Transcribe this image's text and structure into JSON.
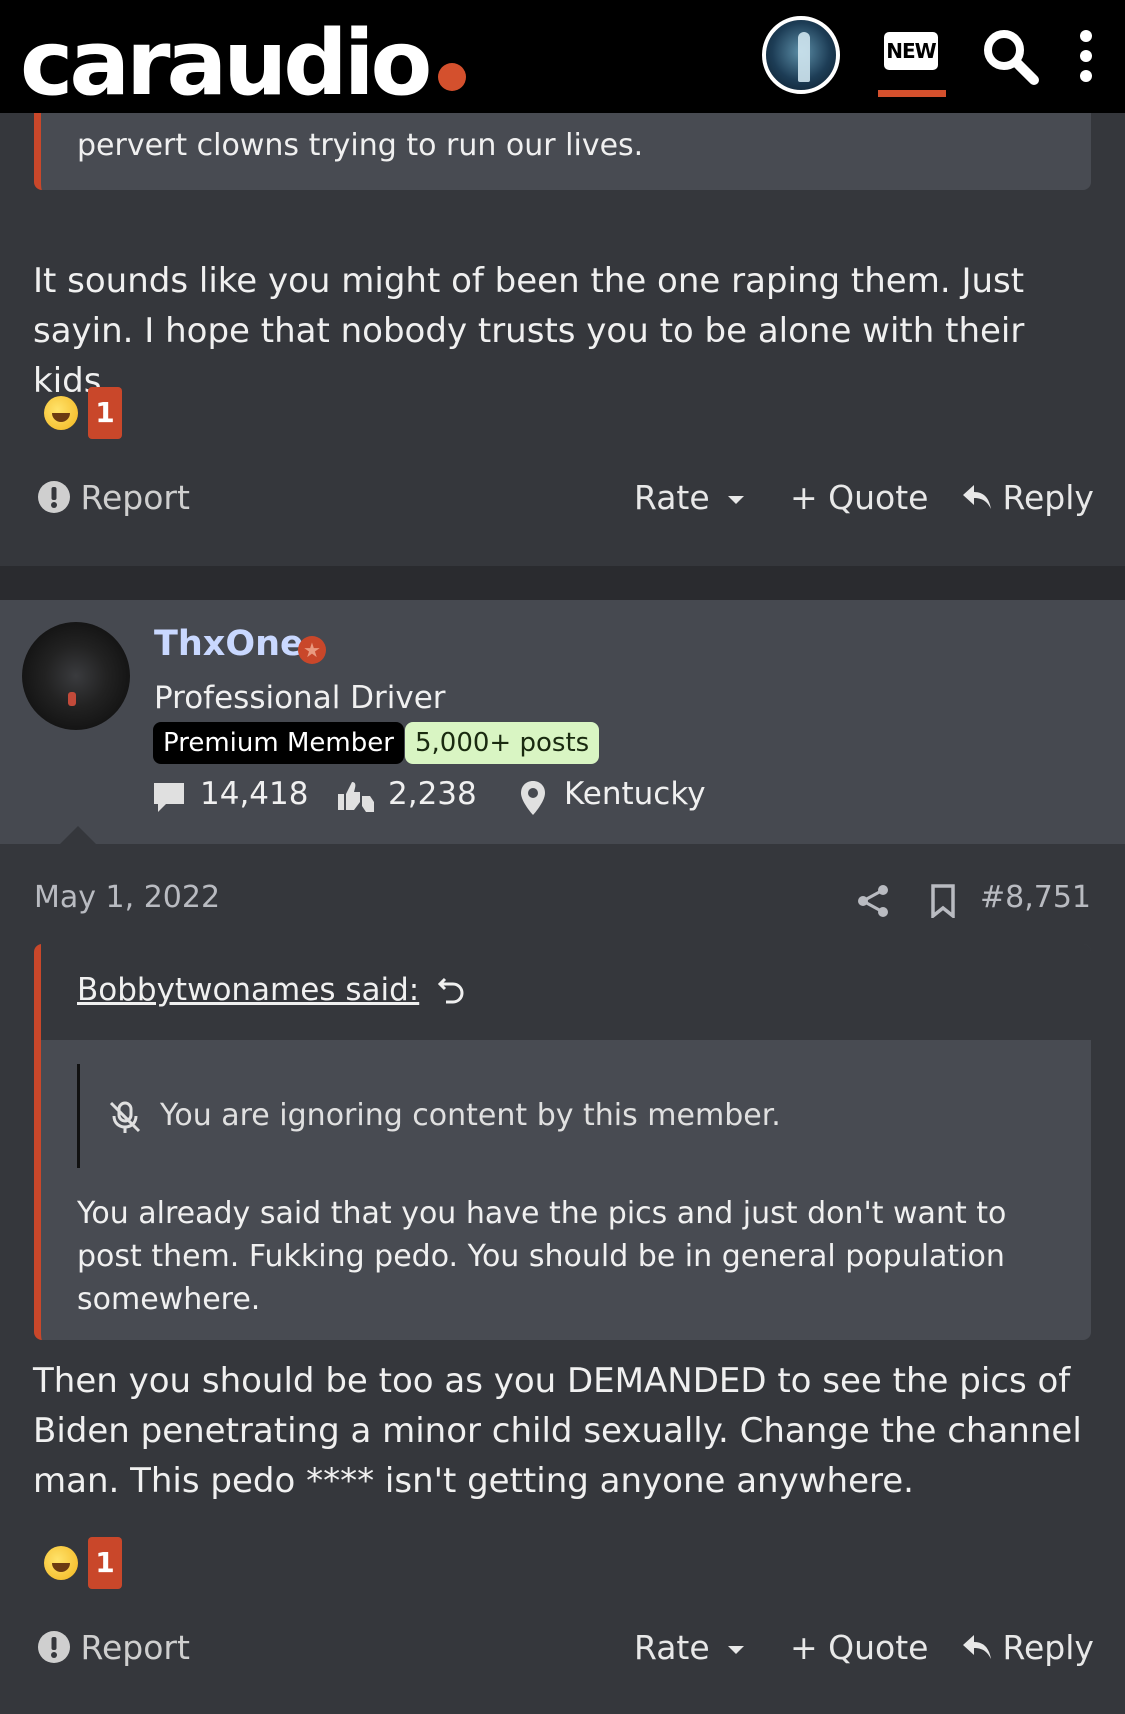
{
  "header": {
    "logo_text": "caraudio",
    "new_label": "NEW",
    "accent_color": "#d4502d"
  },
  "prev_post": {
    "quote_tail": "pervert clowns trying to run our lives.",
    "body": "It sounds like you might of been the one raping them. Just sayin. I hope that nobody trusts you to be alone with their kids.",
    "reaction": {
      "emoji": "rolling-on-floor-laughing",
      "count": "1"
    },
    "actions": {
      "report": "Report",
      "rate": "Rate",
      "quote": "+ Quote",
      "reply": "Reply"
    }
  },
  "post": {
    "author": {
      "username": "ThxOne",
      "title": "Professional Driver",
      "badge_premium": "Premium Member",
      "badge_posts": "5,000+ posts",
      "messages": "14,418",
      "reactions": "2,238",
      "location": "Kentucky"
    },
    "date": "May 1, 2022",
    "number": "#8,751",
    "quote": {
      "author": "Bobbytwonames said:",
      "ignored_notice": "You are ignoring content by this member.",
      "text": "You already said that you have the pics and just don't want to post them. Fukking pedo. You should be in general population somewhere."
    },
    "body": "Then you should be too as you DEMANDED to see the pics of Biden penetrating a minor child sexually. Change the channel man. This pedo **** isn't getting anyone anywhere.",
    "reaction": {
      "emoji": "rolling-on-floor-laughing",
      "count": "1"
    },
    "actions": {
      "report": "Report",
      "rate": "Rate",
      "quote": "+ Quote",
      "reply": "Reply"
    }
  }
}
